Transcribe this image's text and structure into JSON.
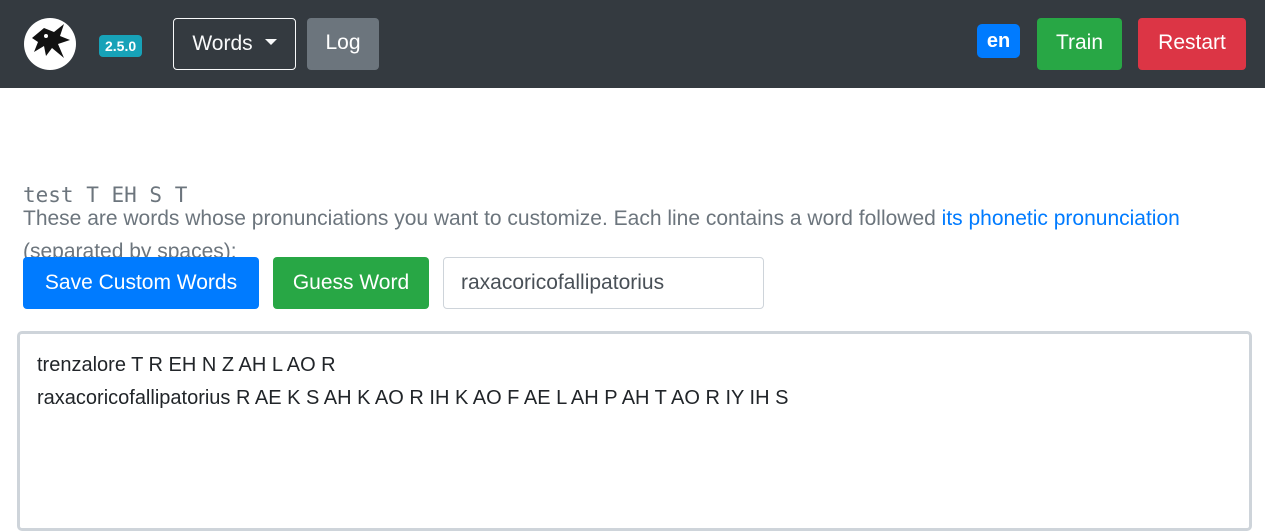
{
  "navbar": {
    "logo_icon": "raven-logo-icon",
    "version": "2.5.0",
    "words_label": "Words",
    "log_label": "Log",
    "language": "en",
    "train_label": "Train",
    "restart_label": "Restart"
  },
  "description": {
    "text_before": "These are words whose pronunciations you want to customize. Each line contains a word followed ",
    "link_text": "its phonetic pronunciation",
    "text_after": " (separated by spaces):",
    "example": "test T EH S T"
  },
  "actions": {
    "save_label": "Save Custom Words",
    "guess_label": "Guess Word",
    "guess_input_value": "raxacoricofallipatorius"
  },
  "custom_words": {
    "lines": [
      "trenzalore T R EH N Z AH L AO R",
      "raxacoricofallipatorius R AE K S AH K AO R IH K AO F AE L AH P AH T AO R IY IH S"
    ]
  },
  "colors": {
    "navbar_bg": "#343a40",
    "primary": "#007bff",
    "success": "#28a745",
    "danger": "#dc3545",
    "secondary": "#6c757d",
    "info": "#17a2b8"
  }
}
